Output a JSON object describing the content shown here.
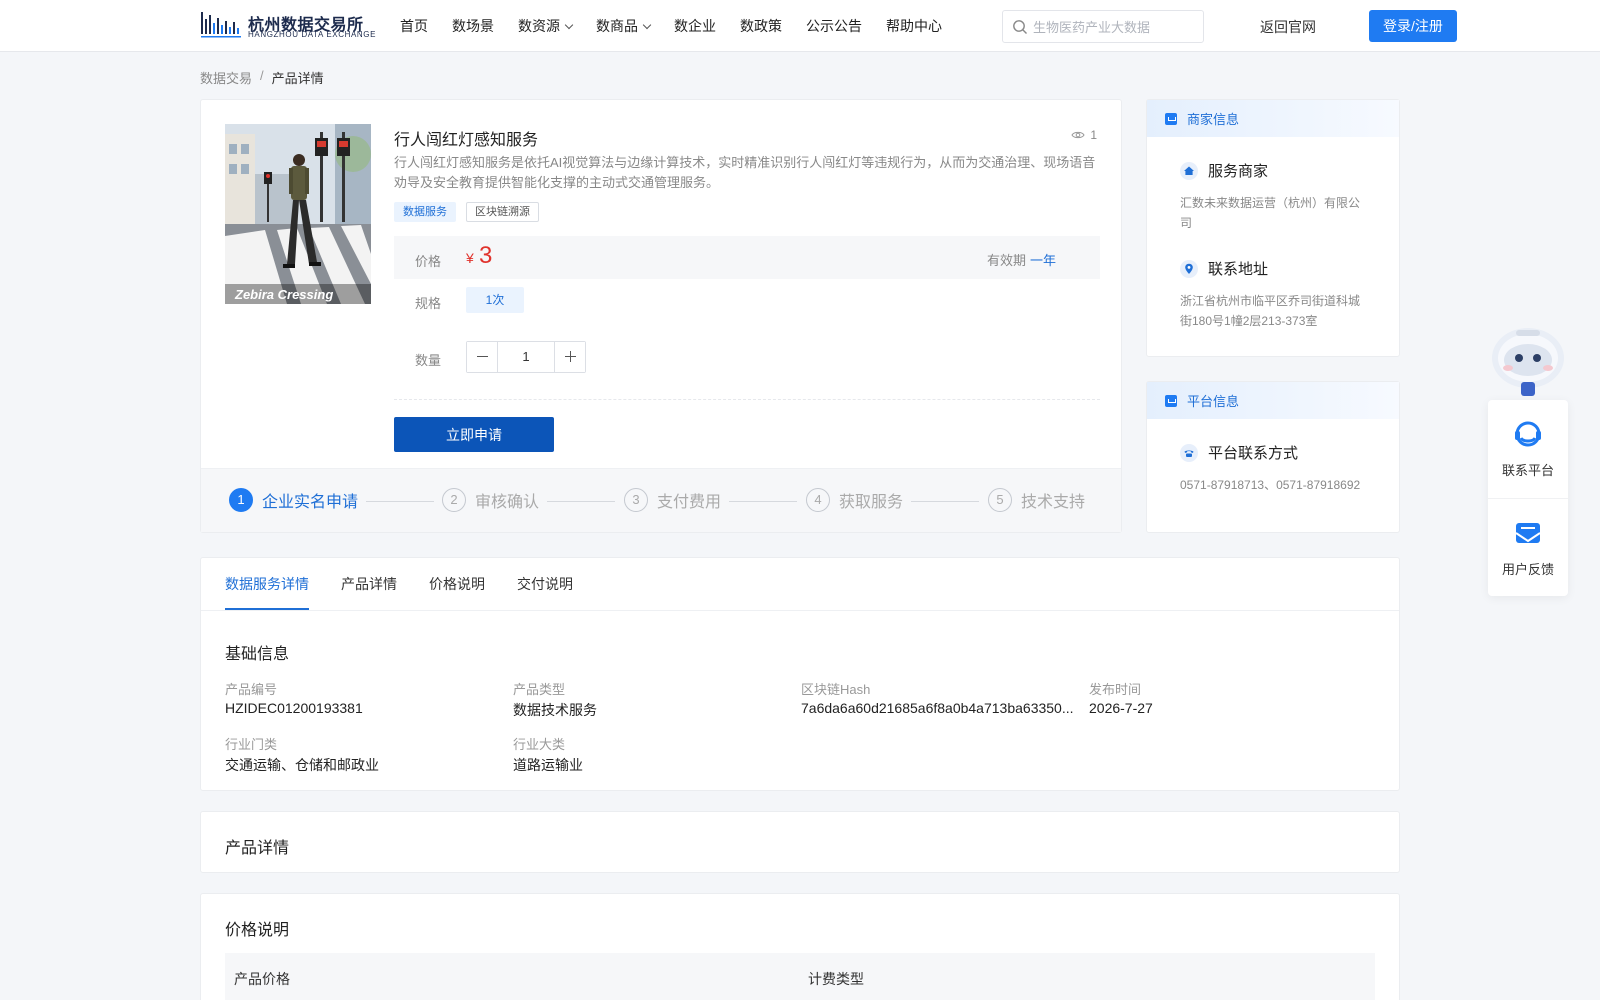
{
  "header": {
    "logo_cn": "杭州数据交易所",
    "logo_en": "HANGZHOU DATA EXCHANGE",
    "nav": [
      {
        "label": "首页",
        "dropdown": false
      },
      {
        "label": "数场景",
        "dropdown": false
      },
      {
        "label": "数资源",
        "dropdown": true
      },
      {
        "label": "数商品",
        "dropdown": true
      },
      {
        "label": "数企业",
        "dropdown": false
      },
      {
        "label": "数政策",
        "dropdown": false
      },
      {
        "label": "公示公告",
        "dropdown": false
      },
      {
        "label": "帮助中心",
        "dropdown": false
      }
    ],
    "search_placeholder": "生物医药产业大数据",
    "back_label": "返回官网",
    "login_label": "登录/注册"
  },
  "breadcrumb": {
    "parent": "数据交易",
    "sep": "/",
    "current": "产品详情"
  },
  "product": {
    "title": "行人闯红灯感知服务",
    "views": "1",
    "image_caption": "Zebira Cressing",
    "description": "行人闯红灯感知服务是依托AI视觉算法与边缘计算技术，实时精准识别行人闯红灯等违规行为，从而为交通治理、现场语音劝导及安全教育提供智能化支撑的主动式交通管理服务。",
    "tags": [
      "数据服务",
      "区块链溯源"
    ],
    "price_label": "价格",
    "currency": "¥",
    "price": "3",
    "validity_label": "有效期",
    "validity": "一年",
    "spec_label": "规格",
    "spec_option": "1次",
    "qty_label": "数量",
    "qty": "1",
    "apply_label": "立即申请",
    "steps": [
      {
        "num": "1",
        "label": "企业实名申请",
        "active": true
      },
      {
        "num": "2",
        "label": "审核确认",
        "active": false
      },
      {
        "num": "3",
        "label": "支付费用",
        "active": false
      },
      {
        "num": "4",
        "label": "获取服务",
        "active": false
      },
      {
        "num": "5",
        "label": "技术支持",
        "active": false
      }
    ]
  },
  "merchant": {
    "header": "商家信息",
    "service_title": "服务商家",
    "service_value": "汇数未来数据运营（杭州）有限公司",
    "address_title": "联系地址",
    "address_value": "浙江省杭州市临平区乔司街道科城街180号1幢2层213-373室"
  },
  "platform": {
    "header": "平台信息",
    "contact_title": "平台联系方式",
    "contact_value": "0571-87918713、0571-87918692"
  },
  "floating": {
    "contact": "联系平台",
    "feedback": "用户反馈"
  },
  "tabs": [
    "数据服务详情",
    "产品详情",
    "价格说明",
    "交付说明"
  ],
  "basic_info": {
    "title": "基础信息",
    "fields": [
      {
        "key": "产品编号",
        "value": "HZIDEC01200193381"
      },
      {
        "key": "产品类型",
        "value": "数据技术服务"
      },
      {
        "key": "区块链Hash",
        "value": "7a6da6a60d21685a6f8a0b4a713ba63350..."
      },
      {
        "key": "发布时间",
        "value": "2026-7-27"
      },
      {
        "key": "行业门类",
        "value": "交通运输、仓储和邮政业"
      },
      {
        "key": "行业大类",
        "value": "道路运输业"
      }
    ]
  },
  "product_detail": {
    "title": "产品详情"
  },
  "price_desc": {
    "title": "价格说明",
    "col1": "产品价格",
    "col2": "计费类型"
  },
  "colors": {
    "primary": "#1f7bf2",
    "primary_dark": "#0c55b8",
    "price": "#e0322c"
  }
}
